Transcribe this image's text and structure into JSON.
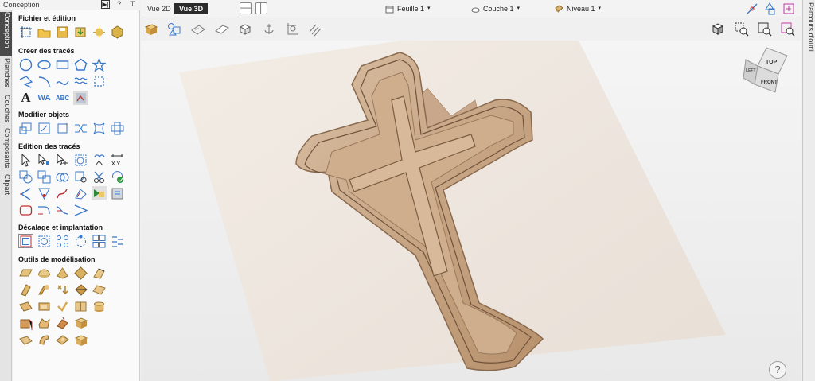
{
  "panel": {
    "title": "Conception",
    "buttons": [
      "▶|",
      "?",
      "⊤"
    ],
    "sections": [
      {
        "title": "Fichier et édition"
      },
      {
        "title": "Créer des tracés"
      },
      {
        "title": "Modifier objets"
      },
      {
        "title": "Edition des tracés"
      },
      {
        "title": "Décalage et implantation"
      },
      {
        "title": "Outils de modélisation"
      }
    ]
  },
  "left_tabs": [
    "Conception",
    "Planches",
    "Couches",
    "Composants",
    "Clipart"
  ],
  "right_tab": "Parcours d'outil",
  "topbar": {
    "view2d": "Vue 2D",
    "view3d": "Vue 3D",
    "sheet": "Feuille 1",
    "layer": "Couche 1",
    "level": "Niveau 1"
  },
  "text_tools": {
    "big_a": "A",
    "wa": "WA",
    "abc": "ABC"
  },
  "view_cube": {
    "top": "TOP",
    "front": "FRONT",
    "left": "LEFT"
  },
  "help_label": "?",
  "colors": {
    "accent": "#3a78c8",
    "wood": "#c9a98a",
    "sheet": "#efe8e0"
  }
}
